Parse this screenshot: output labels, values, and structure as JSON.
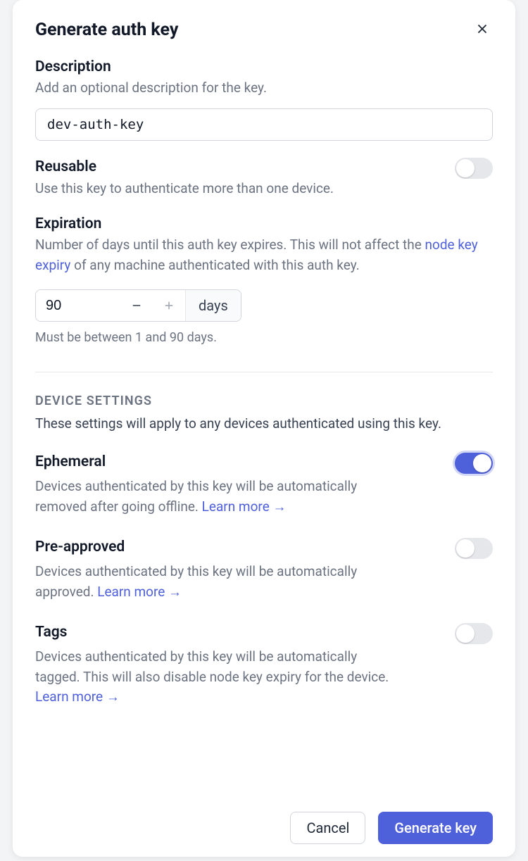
{
  "modal": {
    "title": "Generate auth key"
  },
  "description": {
    "label": "Description",
    "hint": "Add an optional description for the key.",
    "value": "dev-auth-key"
  },
  "reusable": {
    "label": "Reusable",
    "hint": "Use this key to authenticate more than one device.",
    "enabled": false
  },
  "expiration": {
    "label": "Expiration",
    "hint_pre": "Number of days until this auth key expires. This will not affect the ",
    "hint_link": "node key expiry",
    "hint_post": " of any machine authenticated with this auth key.",
    "value": "90",
    "unit": "days",
    "constraint": "Must be between 1 and 90 days."
  },
  "device_settings": {
    "heading": "DEVICE SETTINGS",
    "intro": "These settings will apply to any devices authenticated using this key."
  },
  "ephemeral": {
    "label": "Ephemeral",
    "desc": "Devices authenticated by this key will be automatically removed after going offline. ",
    "learn": "Learn more →",
    "enabled": true
  },
  "preapproved": {
    "label": "Pre-approved",
    "desc": "Devices authenticated by this key will be automatically approved. ",
    "learn": "Learn more →",
    "enabled": false
  },
  "tags": {
    "label": "Tags",
    "desc": "Devices authenticated by this key will be automatically tagged. This will also disable node key expiry for the device. ",
    "learn": "Learn more →",
    "enabled": false
  },
  "footer": {
    "cancel": "Cancel",
    "submit": "Generate key"
  }
}
